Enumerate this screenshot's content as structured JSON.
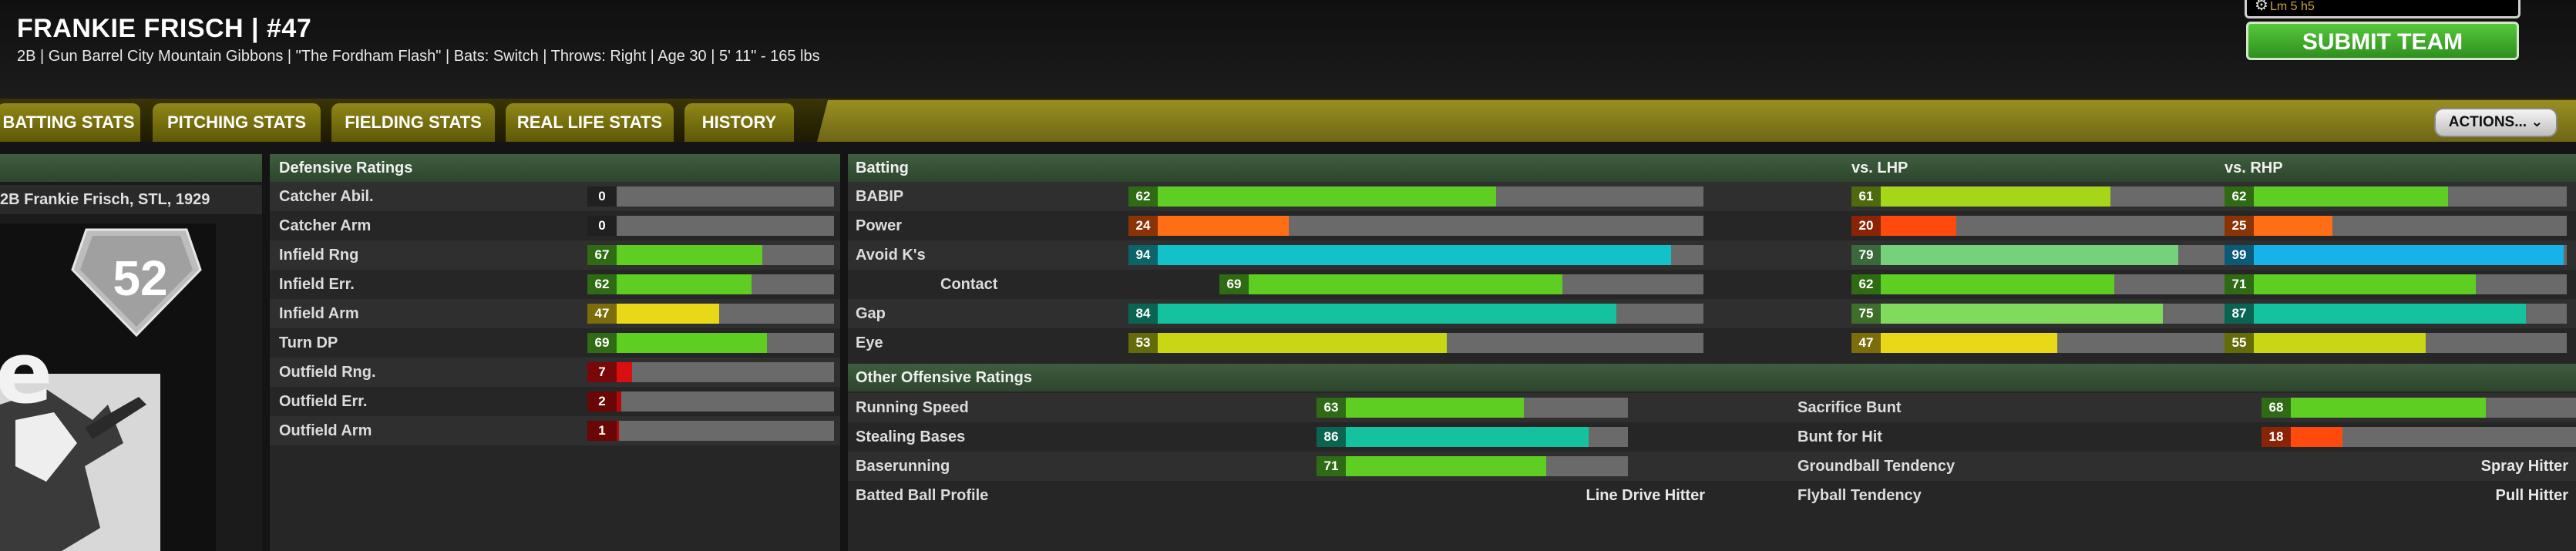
{
  "header": {
    "player_name": "FRANKIE FRISCH  |  #47",
    "player_info": "2B | Gun Barrel City Mountain Gibbons  |  \"The Fordham Flash\"  | Bats: Switch  |  Throws: Right  |  Age 30  |  5' 11\" - 165 lbs",
    "top_chip_text": "Lm 5 h5",
    "submit_label": "SUBMIT TEAM"
  },
  "tabs": [
    {
      "label": "BATTING STATS"
    },
    {
      "label": "PITCHING STATS"
    },
    {
      "label": "FIELDING STATS"
    },
    {
      "label": "REAL LIFE STATS"
    },
    {
      "label": "HISTORY"
    }
  ],
  "actions_label": "ACTIONS... ⌄",
  "card": {
    "caption": "2B Frankie Frisch, STL, 1929",
    "number": "52",
    "letter": "e"
  },
  "defense": {
    "title": "Defensive Ratings",
    "rows": [
      {
        "label": "Catcher Abil.",
        "value": "0",
        "num": 0,
        "color": "#3c3c3c",
        "badge": "#202020"
      },
      {
        "label": "Catcher Arm",
        "value": "0",
        "num": 0,
        "color": "#3c3c3c",
        "badge": "#202020"
      },
      {
        "label": "Infield Rng",
        "value": "67",
        "num": 67,
        "color": "#5ecf22",
        "badge": "#2f6b14"
      },
      {
        "label": "Infield Err.",
        "value": "62",
        "num": 62,
        "color": "#5ecf22",
        "badge": "#2f6b14"
      },
      {
        "label": "Infield Arm",
        "value": "47",
        "num": 47,
        "color": "#e8d818",
        "badge": "#7a6d0a"
      },
      {
        "label": "Turn DP",
        "value": "69",
        "num": 69,
        "color": "#5ecf22",
        "badge": "#2f6b14"
      },
      {
        "label": "Outfield Rng.",
        "value": "7",
        "num": 7,
        "color": "#d81010",
        "badge": "#7a0808"
      },
      {
        "label": "Outfield Err.",
        "value": "2",
        "num": 2,
        "color": "#b00a0a",
        "badge": "#6a0606"
      },
      {
        "label": "Outfield Arm",
        "value": "1",
        "num": 1,
        "color": "#b00a0a",
        "badge": "#6a0606"
      }
    ]
  },
  "batting": {
    "title": "Batting",
    "vs_lhp_title": "vs. LHP",
    "vs_rhp_title": "vs. RHP",
    "rows": [
      {
        "label": "BABIP",
        "indent": false,
        "overall": {
          "value": "62",
          "num": 62,
          "color": "#5ecf22",
          "badge": "#2f6b14"
        },
        "lhp": {
          "value": "61",
          "num": 61,
          "color": "#a6d618",
          "badge": "#4e6a0c"
        },
        "rhp": {
          "value": "62",
          "num": 62,
          "color": "#5ecf22",
          "badge": "#2f6b14"
        }
      },
      {
        "label": "Power",
        "indent": false,
        "overall": {
          "value": "24",
          "num": 24,
          "color": "#ff6e14",
          "badge": "#8a3406"
        },
        "lhp": {
          "value": "20",
          "num": 20,
          "color": "#ff4a0e",
          "badge": "#8a2406"
        },
        "rhp": {
          "value": "25",
          "num": 25,
          "color": "#ff6e14",
          "badge": "#8a3406"
        }
      },
      {
        "label": "Avoid K's",
        "indent": false,
        "overall": {
          "value": "94",
          "num": 94,
          "color": "#12c2c8",
          "badge": "#0a6468"
        },
        "lhp": {
          "value": "79",
          "num": 79,
          "color": "#76d27a",
          "badge": "#3a6a3c"
        },
        "rhp": {
          "value": "99",
          "num": 99,
          "color": "#18b2ea",
          "badge": "#0a5a78"
        }
      },
      {
        "label": "Contact",
        "indent": true,
        "overall": {
          "value": "69",
          "num": 69,
          "color": "#5ecf22",
          "badge": "#2f6b14"
        },
        "lhp": {
          "value": "62",
          "num": 62,
          "color": "#5ecf22",
          "badge": "#2f6b14"
        },
        "rhp": {
          "value": "71",
          "num": 71,
          "color": "#5ecf22",
          "badge": "#2f6b14"
        }
      },
      {
        "label": "Gap",
        "indent": false,
        "overall": {
          "value": "84",
          "num": 84,
          "color": "#14c2a0",
          "badge": "#0a6452"
        },
        "lhp": {
          "value": "75",
          "num": 75,
          "color": "#80da5c",
          "badge": "#3e6e2c"
        },
        "rhp": {
          "value": "87",
          "num": 87,
          "color": "#14c2a0",
          "badge": "#0a6452"
        }
      },
      {
        "label": "Eye",
        "indent": false,
        "overall": {
          "value": "53",
          "num": 53,
          "color": "#c8d614",
          "badge": "#646c0a"
        },
        "lhp": {
          "value": "47",
          "num": 47,
          "color": "#e8d818",
          "badge": "#7a6d0a"
        },
        "rhp": {
          "value": "55",
          "num": 55,
          "color": "#c8d614",
          "badge": "#646c0a"
        }
      }
    ]
  },
  "other": {
    "title": "Other Offensive Ratings",
    "left_rows": [
      {
        "label": "Running Speed",
        "value": "63",
        "num": 63,
        "color": "#5ecf22",
        "badge": "#2f6b14"
      },
      {
        "label": "Stealing Bases",
        "value": "86",
        "num": 86,
        "color": "#14c2a0",
        "badge": "#0a6452"
      },
      {
        "label": "Baserunning",
        "value": "71",
        "num": 71,
        "color": "#5ecf22",
        "badge": "#2f6b14"
      }
    ],
    "batted_ball_label": "Batted Ball Profile",
    "batted_ball_value": "Line Drive Hitter",
    "right_rows": [
      {
        "label": "Sacrifice Bunt",
        "value": "68",
        "num": 68,
        "color": "#5ecf22",
        "badge": "#2f6b14"
      },
      {
        "label": "Bunt for Hit",
        "value": "18",
        "num": 18,
        "color": "#ff4a0e",
        "badge": "#8a2406"
      }
    ],
    "groundball_label": "Groundball Tendency",
    "groundball_value": "Spray Hitter",
    "flyball_label": "Flyball Tendency",
    "flyball_value": "Pull Hitter"
  }
}
